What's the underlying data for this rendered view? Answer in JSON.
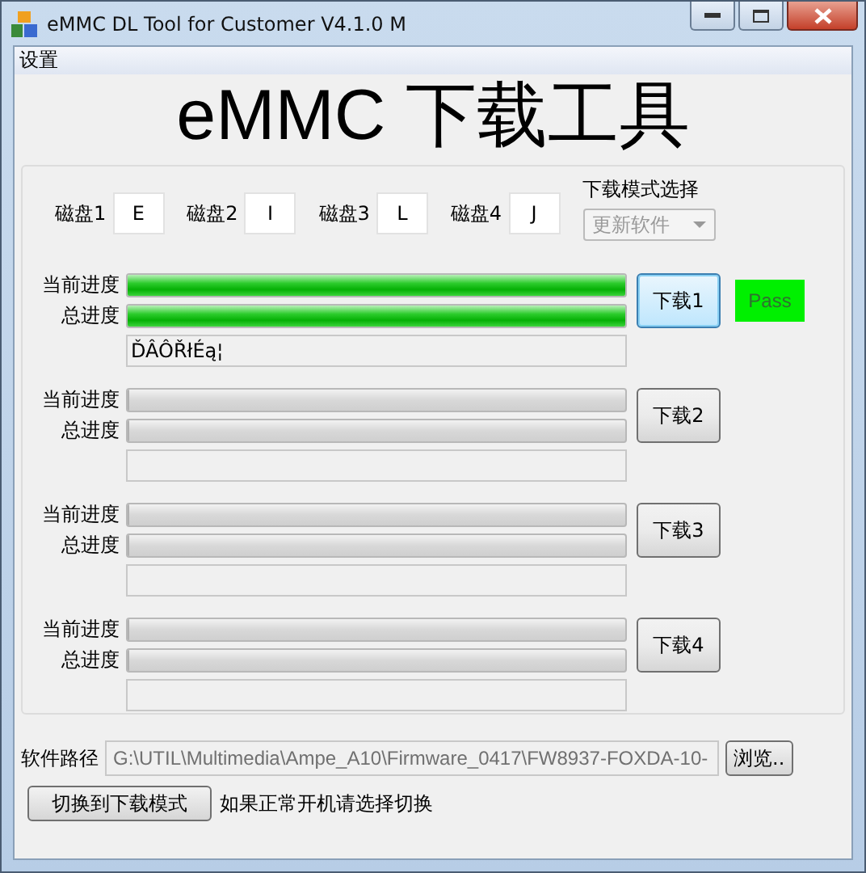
{
  "window": {
    "title": "eMMC DL Tool for Customer V4.1.0 M"
  },
  "menu": [
    "设置"
  ],
  "heading": "eMMC 下载工具",
  "disks": [
    {
      "label": "磁盘1",
      "value": "E"
    },
    {
      "label": "磁盘2",
      "value": "I"
    },
    {
      "label": "磁盘3",
      "value": "L"
    },
    {
      "label": "磁盘4",
      "value": "J"
    }
  ],
  "mode": {
    "label": "下载模式选择",
    "value": "更新软件",
    "disabled": true
  },
  "slots": [
    {
      "current": {
        "label": "当前进度",
        "level": 1
      },
      "total": {
        "label": "总进度",
        "level": 1
      },
      "status": "ĎÂÔŘłÉą¦",
      "button": "下载1",
      "focused": true,
      "result": "Pass"
    },
    {
      "current": {
        "label": "当前进度",
        "level": 0
      },
      "total": {
        "label": "总进度",
        "level": 0
      },
      "button": "下载2",
      "focused": false
    },
    {
      "current": {
        "label": "当前进度",
        "level": 0
      },
      "total": {
        "label": "总进度",
        "level": 0
      },
      "button": "下载3",
      "focused": false
    },
    {
      "current": {
        "label": "当前进度",
        "level": 0
      },
      "total": {
        "label": "总进度",
        "level": 0
      },
      "button": "下载4",
      "focused": false
    }
  ],
  "path": {
    "label": "软件路径",
    "value": "G:\\UTIL\\Multimedia\\Ampe_A10\\Firmware_0417\\FW8937-FOXDA-10-",
    "disabled": true,
    "browse": "浏览.."
  },
  "switch_button": "切换到下载模式",
  "hint": "如果正常开机请选择切换"
}
